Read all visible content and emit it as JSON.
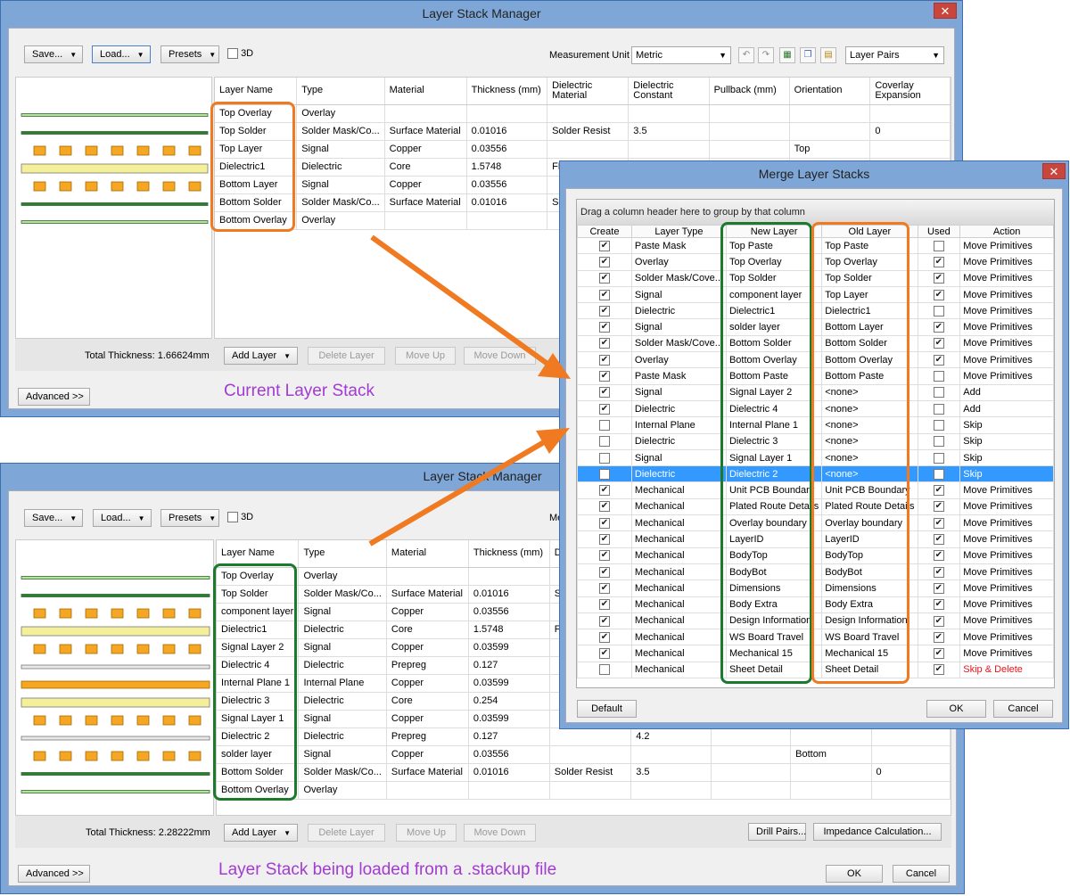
{
  "top_window": {
    "title": "Layer Stack Manager",
    "close_glyph": "✕",
    "toolbar": {
      "save": "Save...",
      "load": "Load...",
      "presets": "Presets",
      "threeD": "3D",
      "measurement_label": "Measurement Unit",
      "measurement_value": "Metric",
      "layer_pairs": "Layer Pairs"
    },
    "columns": [
      "Layer Name",
      "Type",
      "Material",
      "Thickness (mm)",
      "Dielectric Material",
      "Dielectric Constant",
      "Pullback (mm)",
      "Orientation",
      "Coverlay Expansion"
    ],
    "rows": [
      [
        "Top Overlay",
        "Overlay",
        "",
        "",
        "",
        "",
        "",
        "",
        ""
      ],
      [
        "Top Solder",
        "Solder Mask/Co...",
        "Surface Material",
        "0.01016",
        "Solder Resist",
        "3.5",
        "",
        "",
        "0"
      ],
      [
        "Top Layer",
        "Signal",
        "Copper",
        "0.03556",
        "",
        "",
        "",
        "Top",
        ""
      ],
      [
        "Dielectric1",
        "Dielectric",
        "Core",
        "1.5748",
        "FR-4",
        "",
        "",
        "",
        ""
      ],
      [
        "Bottom Layer",
        "Signal",
        "Copper",
        "0.03556",
        "",
        "",
        "",
        "",
        ""
      ],
      [
        "Bottom Solder",
        "Solder Mask/Co...",
        "Surface Material",
        "0.01016",
        "Sold",
        "",
        "",
        "",
        ""
      ],
      [
        "Bottom Overlay",
        "Overlay",
        "",
        "",
        "",
        "",
        "",
        "",
        ""
      ]
    ],
    "total_thickness": "Total Thickness: 1.66624mm",
    "add_layer": "Add Layer",
    "delete_layer": "Delete Layer",
    "move_up": "Move Up",
    "move_down": "Move Down",
    "advanced": "Advanced >>",
    "annotation": "Current Layer Stack"
  },
  "bottom_window": {
    "title": "Layer Stack Manager",
    "toolbar": {
      "save": "Save...",
      "load": "Load...",
      "presets": "Presets",
      "threeD": "3D",
      "measurement_label_partial": "Me"
    },
    "columns": [
      "Layer Name",
      "Type",
      "Material",
      "Thickness (mm)",
      "Diel Ma",
      "",
      "",
      "",
      ""
    ],
    "rows": [
      [
        "Top Overlay",
        "Overlay",
        "",
        "",
        "",
        "",
        "",
        "",
        ""
      ],
      [
        "Top Solder",
        "Solder Mask/Co...",
        "Surface Material",
        "0.01016",
        "Sold",
        "",
        "",
        "",
        ""
      ],
      [
        "component layer",
        "Signal",
        "Copper",
        "0.03556",
        "",
        "",
        "",
        "",
        ""
      ],
      [
        "Dielectric1",
        "Dielectric",
        "Core",
        "1.5748",
        "FR-4",
        "",
        "",
        "",
        ""
      ],
      [
        "Signal Layer 2",
        "Signal",
        "Copper",
        "0.03599",
        "",
        "",
        "",
        "",
        ""
      ],
      [
        "Dielectric 4",
        "Dielectric",
        "Prepreg",
        "0.127",
        "",
        "",
        "",
        "",
        ""
      ],
      [
        "Internal Plane 1",
        "Internal Plane",
        "Copper",
        "0.03599",
        "",
        "",
        "",
        "",
        ""
      ],
      [
        "Dielectric 3",
        "Dielectric",
        "Core",
        "0.254",
        "",
        "",
        "",
        "",
        ""
      ],
      [
        "Signal Layer 1",
        "Signal",
        "Copper",
        "0.03599",
        "",
        "",
        "",
        "",
        ""
      ],
      [
        "Dielectric 2",
        "Dielectric",
        "Prepreg",
        "0.127",
        "",
        "4.2",
        "",
        "",
        ""
      ],
      [
        "solder layer",
        "Signal",
        "Copper",
        "0.03556",
        "",
        "",
        "",
        "Bottom",
        ""
      ],
      [
        "Bottom Solder",
        "Solder Mask/Co...",
        "Surface Material",
        "0.01016",
        "Solder Resist",
        "3.5",
        "",
        "",
        "0"
      ],
      [
        "Bottom Overlay",
        "Overlay",
        "",
        "",
        "",
        "",
        "",
        "",
        ""
      ]
    ],
    "total_thickness": "Total Thickness: 2.28222mm",
    "add_layer": "Add Layer",
    "delete_layer": "Delete Layer",
    "move_up": "Move Up",
    "move_down": "Move Down",
    "drill_pairs": "Drill Pairs...",
    "impedance": "Impedance Calculation...",
    "advanced": "Advanced >>",
    "ok": "OK",
    "cancel": "Cancel",
    "annotation": "Layer Stack being loaded from a .stackup file"
  },
  "merge_dialog": {
    "title": "Merge Layer Stacks",
    "close_glyph": "✕",
    "group_hint": "Drag a column header here to group by that column",
    "columns": [
      "Create",
      "Layer Type",
      "New Layer",
      "Old Layer",
      "Used",
      "Action"
    ],
    "rows": [
      {
        "create": true,
        "type": "Paste Mask",
        "new": "Top Paste",
        "old": "Top Paste",
        "used": false,
        "action": "Move Primitives"
      },
      {
        "create": true,
        "type": "Overlay",
        "new": "Top Overlay",
        "old": "Top Overlay",
        "used": true,
        "action": "Move Primitives"
      },
      {
        "create": true,
        "type": "Solder Mask/Cove...",
        "new": "Top Solder",
        "old": "Top Solder",
        "used": true,
        "action": "Move Primitives"
      },
      {
        "create": true,
        "type": "Signal",
        "new": "component layer",
        "old": "Top Layer",
        "used": true,
        "action": "Move Primitives"
      },
      {
        "create": true,
        "type": "Dielectric",
        "new": "Dielectric1",
        "old": "Dielectric1",
        "used": false,
        "action": "Move Primitives"
      },
      {
        "create": true,
        "type": "Signal",
        "new": "solder layer",
        "old": "Bottom Layer",
        "used": true,
        "action": "Move Primitives"
      },
      {
        "create": true,
        "type": "Solder Mask/Cove...",
        "new": "Bottom Solder",
        "old": "Bottom Solder",
        "used": true,
        "action": "Move Primitives"
      },
      {
        "create": true,
        "type": "Overlay",
        "new": "Bottom Overlay",
        "old": "Bottom Overlay",
        "used": true,
        "action": "Move Primitives"
      },
      {
        "create": true,
        "type": "Paste Mask",
        "new": "Bottom Paste",
        "old": "Bottom Paste",
        "used": false,
        "action": "Move Primitives"
      },
      {
        "create": true,
        "type": "Signal",
        "new": "Signal Layer 2",
        "old": "<none>",
        "used": false,
        "action": "Add"
      },
      {
        "create": true,
        "type": "Dielectric",
        "new": "Dielectric 4",
        "old": "<none>",
        "used": false,
        "action": "Add"
      },
      {
        "create": false,
        "type": "Internal Plane",
        "new": "Internal Plane 1",
        "old": "<none>",
        "used": false,
        "action": "Skip"
      },
      {
        "create": false,
        "type": "Dielectric",
        "new": "Dielectric 3",
        "old": "<none>",
        "used": false,
        "action": "Skip"
      },
      {
        "create": false,
        "type": "Signal",
        "new": "Signal Layer 1",
        "old": "<none>",
        "used": false,
        "action": "Skip"
      },
      {
        "create": false,
        "type": "Dielectric",
        "new": "Dielectric 2",
        "old": "<none>",
        "used": false,
        "action": "Skip",
        "selected": true
      },
      {
        "create": true,
        "type": "Mechanical",
        "new": "Unit PCB Boundary",
        "old": "Unit PCB Boundary",
        "used": true,
        "action": "Move Primitives"
      },
      {
        "create": true,
        "type": "Mechanical",
        "new": "Plated Route Details",
        "old": "Plated Route Details",
        "used": true,
        "action": "Move Primitives"
      },
      {
        "create": true,
        "type": "Mechanical",
        "new": "Overlay boundary",
        "old": "Overlay boundary",
        "used": true,
        "action": "Move Primitives"
      },
      {
        "create": true,
        "type": "Mechanical",
        "new": "LayerID",
        "old": "LayerID",
        "used": true,
        "action": "Move Primitives"
      },
      {
        "create": true,
        "type": "Mechanical",
        "new": "BodyTop",
        "old": "BodyTop",
        "used": true,
        "action": "Move Primitives"
      },
      {
        "create": true,
        "type": "Mechanical",
        "new": "BodyBot",
        "old": "BodyBot",
        "used": true,
        "action": "Move Primitives"
      },
      {
        "create": true,
        "type": "Mechanical",
        "new": "Dimensions",
        "old": "Dimensions",
        "used": true,
        "action": "Move Primitives"
      },
      {
        "create": true,
        "type": "Mechanical",
        "new": "Body Extra",
        "old": "Body Extra",
        "used": true,
        "action": "Move Primitives"
      },
      {
        "create": true,
        "type": "Mechanical",
        "new": "Design Information",
        "old": "Design Information",
        "used": true,
        "action": "Move Primitives"
      },
      {
        "create": true,
        "type": "Mechanical",
        "new": "WS Board Travel",
        "old": "WS Board Travel",
        "used": true,
        "action": "Move Primitives"
      },
      {
        "create": true,
        "type": "Mechanical",
        "new": "Mechanical 15",
        "old": "Mechanical 15",
        "used": true,
        "action": "Move Primitives"
      },
      {
        "create": false,
        "type": "Mechanical",
        "new": "Sheet Detail",
        "old": "Sheet Detail",
        "used": true,
        "action": "Skip & Delete",
        "action_red": true
      }
    ],
    "default_btn": "Default",
    "ok": "OK",
    "cancel": "Cancel"
  },
  "colors": {
    "highlight_orange": "#ef7a22",
    "highlight_green": "#1c7a2c",
    "annotation_purple": "#a23bd1",
    "selection_blue": "#3399ff",
    "window_frame": "#7ea7d8"
  }
}
